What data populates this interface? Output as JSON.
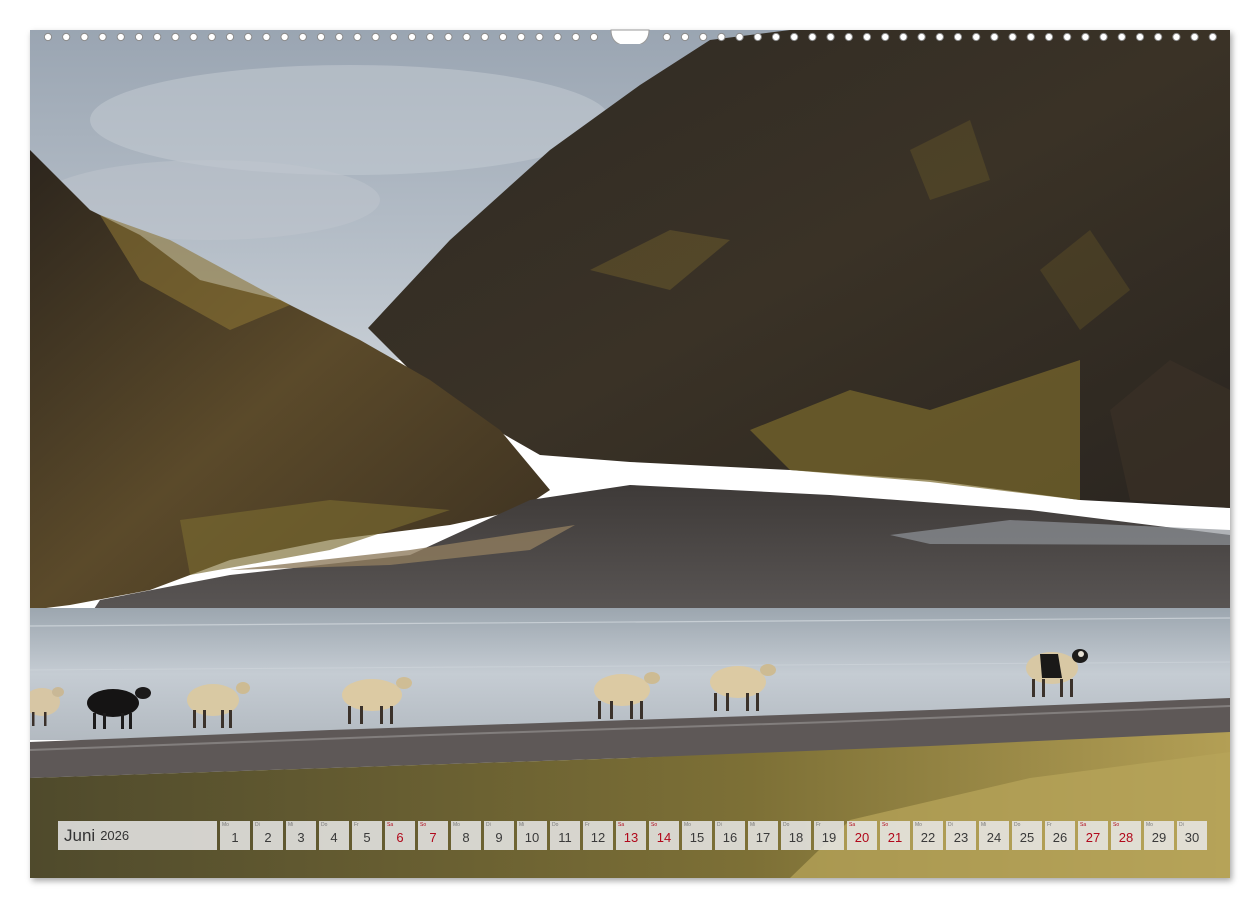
{
  "calendar": {
    "month": "Juni",
    "year": "2026",
    "days": [
      {
        "abbr": "Mo",
        "num": "1",
        "weekend": false
      },
      {
        "abbr": "Di",
        "num": "2",
        "weekend": false
      },
      {
        "abbr": "Mi",
        "num": "3",
        "weekend": false
      },
      {
        "abbr": "Do",
        "num": "4",
        "weekend": false
      },
      {
        "abbr": "Fr",
        "num": "5",
        "weekend": false
      },
      {
        "abbr": "Sa",
        "num": "6",
        "weekend": true
      },
      {
        "abbr": "So",
        "num": "7",
        "weekend": true
      },
      {
        "abbr": "Mo",
        "num": "8",
        "weekend": false
      },
      {
        "abbr": "Di",
        "num": "9",
        "weekend": false
      },
      {
        "abbr": "Mi",
        "num": "10",
        "weekend": false
      },
      {
        "abbr": "Do",
        "num": "11",
        "weekend": false
      },
      {
        "abbr": "Fr",
        "num": "12",
        "weekend": false
      },
      {
        "abbr": "Sa",
        "num": "13",
        "weekend": true
      },
      {
        "abbr": "So",
        "num": "14",
        "weekend": true
      },
      {
        "abbr": "Mo",
        "num": "15",
        "weekend": false
      },
      {
        "abbr": "Di",
        "num": "16",
        "weekend": false
      },
      {
        "abbr": "Mi",
        "num": "17",
        "weekend": false
      },
      {
        "abbr": "Do",
        "num": "18",
        "weekend": false
      },
      {
        "abbr": "Fr",
        "num": "19",
        "weekend": false
      },
      {
        "abbr": "Sa",
        "num": "20",
        "weekend": true
      },
      {
        "abbr": "So",
        "num": "21",
        "weekend": true
      },
      {
        "abbr": "Mo",
        "num": "22",
        "weekend": false
      },
      {
        "abbr": "Di",
        "num": "23",
        "weekend": false
      },
      {
        "abbr": "Mi",
        "num": "24",
        "weekend": false
      },
      {
        "abbr": "Do",
        "num": "25",
        "weekend": false
      },
      {
        "abbr": "Fr",
        "num": "26",
        "weekend": false
      },
      {
        "abbr": "Sa",
        "num": "27",
        "weekend": true
      },
      {
        "abbr": "So",
        "num": "28",
        "weekend": true
      },
      {
        "abbr": "Mo",
        "num": "29",
        "weekend": false
      },
      {
        "abbr": "Di",
        "num": "30",
        "weekend": false
      }
    ]
  },
  "colors": {
    "weekend": "#b1081b",
    "cell_background": "#e8e8e8",
    "sky": "#aeb7c1",
    "cliff_dark": "#3a3126",
    "cliff_moss": "#7d6630",
    "sand": "#4f4b49",
    "lagoon": "#c4ccd3",
    "grass": "#a48f45"
  },
  "icons": {
    "binding": "spiral-binding-rings",
    "hanger": "calendar-hanger-hook"
  }
}
